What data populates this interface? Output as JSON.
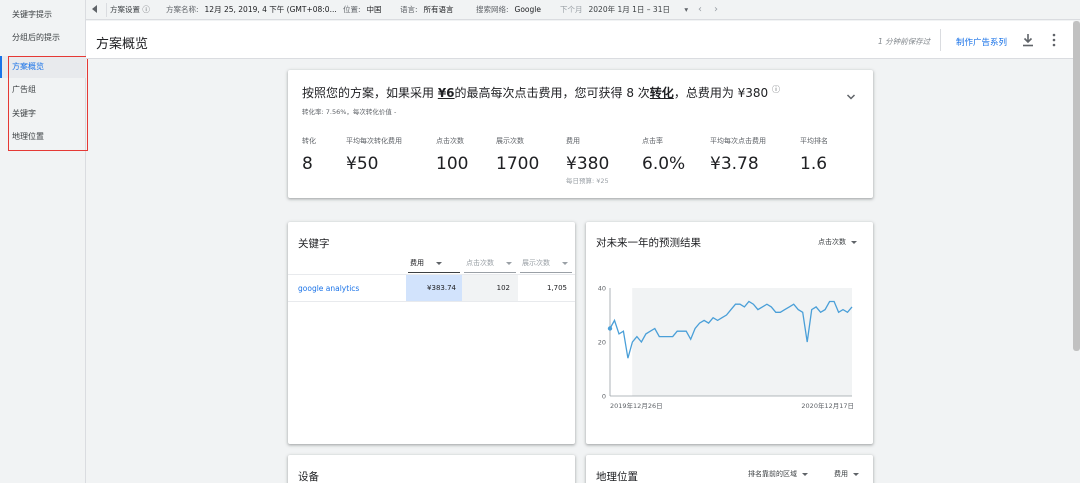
{
  "sidebar": {
    "items": [
      {
        "label": "关键字提示"
      },
      {
        "label": "分组后的提示"
      },
      {
        "label": "方案概览"
      },
      {
        "label": "广告组"
      },
      {
        "label": "关键字"
      },
      {
        "label": "地理位置"
      }
    ],
    "active_index": 2
  },
  "topbar": {
    "plan_settings": "方案设置",
    "plan_name_label": "方案名称:",
    "plan_name_value": "12月 25, 2019, 4 下午 (GMT+08:0...",
    "location_label": "位置:",
    "location_value": "中国",
    "language_label": "语言:",
    "language_value": "所有语言",
    "network_label": "搜索网络:",
    "network_value": "Google",
    "period_label": "下个月",
    "period_value": "2020年 1月 1日 – 31日"
  },
  "header": {
    "title": "方案概览",
    "save_status": "1 分钟前保存过",
    "create_campaign": "制作广告系列"
  },
  "summary": {
    "headline_pre": "按照您的方案，如果采用 ",
    "headline_bid": "¥6",
    "headline_mid": "的最高每次点击费用，您可获得 8 次",
    "headline_conv": "转化",
    "headline_post": "，总费用为 ¥380 ",
    "info_icon": "ⓘ",
    "subline": "转化率: 7.56%，每次转化价值 -",
    "metrics": [
      {
        "label": "转化",
        "value": "8",
        "note": ""
      },
      {
        "label": "平均每次转化费用",
        "value": "¥50",
        "note": ""
      },
      {
        "label": "点击次数",
        "value": "100",
        "note": ""
      },
      {
        "label": "展示次数",
        "value": "1700",
        "note": ""
      },
      {
        "label": "费用",
        "value": "¥380",
        "note": "每日预算: ¥25"
      },
      {
        "label": "点击率",
        "value": "6.0%",
        "note": ""
      },
      {
        "label": "平均每次点击费用",
        "value": "¥3.78",
        "note": ""
      },
      {
        "label": "平均排名",
        "value": "1.6",
        "note": ""
      }
    ]
  },
  "keywords": {
    "title": "关键字",
    "columns": [
      "费用",
      "点击次数",
      "展示次数"
    ],
    "rows": [
      {
        "keyword": "google analytics",
        "cost": "¥383.74",
        "clicks": "102",
        "impressions": "1,705"
      }
    ]
  },
  "forecast": {
    "title": "对未来一年的预测结果",
    "metric_dropdown": "点击次数"
  },
  "chart_data": {
    "type": "line",
    "title": "对未来一年的预测结果",
    "xlabel": "",
    "ylabel": "",
    "x_tick_labels": [
      "2019年12月26日",
      "2020年12月17日"
    ],
    "y_ticks": [
      0,
      20,
      40
    ],
    "ylim": [
      0,
      40
    ],
    "grid": false,
    "color": "#4a9fd8",
    "values": [
      25,
      28,
      23,
      24,
      14,
      20,
      22,
      20,
      23,
      24,
      25,
      22,
      22,
      22,
      22,
      24,
      24,
      24,
      21,
      25,
      27,
      28,
      27,
      29,
      28,
      29,
      30,
      32,
      34,
      34,
      33,
      35,
      34,
      32,
      33,
      34,
      33,
      31,
      31,
      32,
      33,
      34,
      32,
      31,
      20,
      32,
      33,
      31,
      32,
      35,
      35,
      31,
      32,
      31,
      33
    ]
  },
  "devices": {
    "title": "设备"
  },
  "geo": {
    "title": "地理位置",
    "dropdown1": "排名靠前的区域",
    "dropdown2": "费用"
  }
}
